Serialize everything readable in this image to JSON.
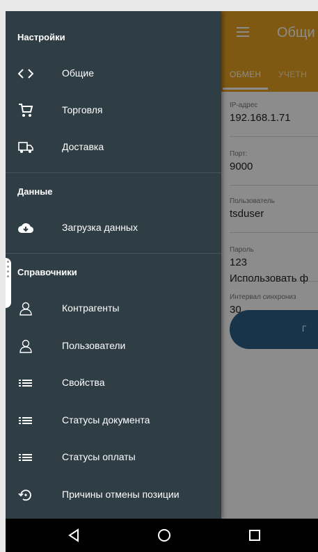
{
  "app": {
    "title": "Общи",
    "tabs": [
      {
        "label": "ОБМЕН",
        "active": true
      },
      {
        "label": "УЧЕТН",
        "active": false
      }
    ],
    "fields": [
      {
        "label": "IP-адрес",
        "value": "192.168.1.71"
      },
      {
        "label": "Порт:",
        "value": "9000"
      },
      {
        "label": "Пользователь",
        "value": "tsduser"
      },
      {
        "label": "Пароль",
        "value": "123"
      },
      {
        "label": "Интервал синхрониз",
        "value": "30"
      }
    ],
    "switch_label": "Использовать ф",
    "button_label": "Г",
    "accent_color": "#e8a11f",
    "button_color": "#2a5f88"
  },
  "drawer": {
    "background_color": "#2f3d45",
    "sections": {
      "settings": "Настройки",
      "data": "Данные",
      "references": "Справочники"
    },
    "items": [
      {
        "label": "Общие",
        "icon": "code-icon"
      },
      {
        "label": "Торговля",
        "icon": "cart-icon"
      },
      {
        "label": "Доставка",
        "icon": "truck-icon"
      },
      {
        "label": "Загрузка данных",
        "icon": "cloud-download-icon"
      },
      {
        "label": "Контрагенты",
        "icon": "person-outline-icon"
      },
      {
        "label": "Пользователи",
        "icon": "person-outline-icon"
      },
      {
        "label": "Свойства",
        "icon": "list-icon"
      },
      {
        "label": "Статусы документа",
        "icon": "list-icon"
      },
      {
        "label": "Статусы оплаты",
        "icon": "list-icon"
      },
      {
        "label": "Причины отмены позиции",
        "icon": "restore-icon"
      }
    ]
  },
  "navbar": {
    "buttons": [
      "back-icon",
      "home-icon",
      "recents-icon"
    ]
  }
}
